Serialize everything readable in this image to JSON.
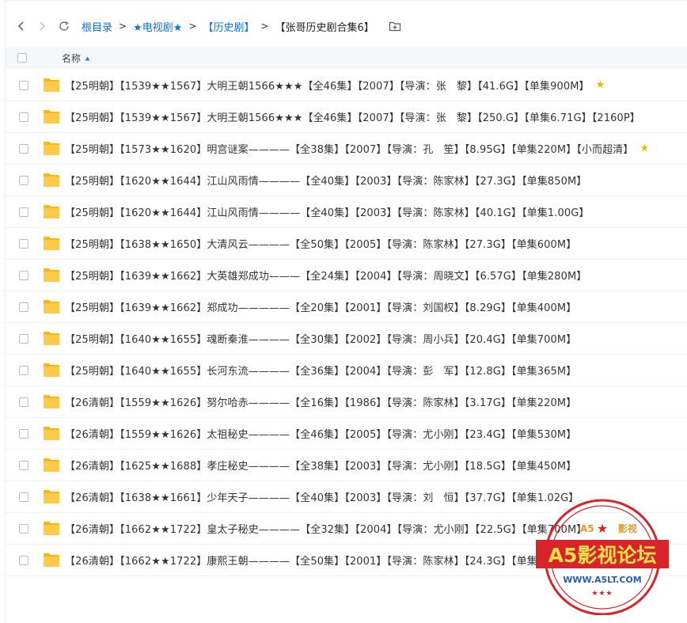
{
  "breadcrumb": {
    "items": [
      "根目录",
      "★电视剧★",
      "【历史剧】",
      "【张哥历史剧合集6】"
    ],
    "separator": ">"
  },
  "table": {
    "column_name": "名称"
  },
  "files": [
    {
      "name": "【25明朝】【1539★★1567】大明王朝1566★★★【全46集】【2007】【导演：张　黎】【41.6G】【单集900M】",
      "starred": true
    },
    {
      "name": "【25明朝】【1539★★1567】大明王朝1566★★★【全46集】【2007】【导演：张　黎】【250.G】【单集6.71G】【2160P】",
      "starred": false
    },
    {
      "name": "【25明朝】【1573★★1620】明宫谜案————【全38集】【2007】【导演：孔　笙】【8.95G】【单集220M】【小而超清】",
      "starred": true
    },
    {
      "name": "【25明朝】【1620★★1644】江山风雨情————【全40集】【2003】【导演：陈家林】【27.3G】【单集850M】",
      "starred": false
    },
    {
      "name": "【25明朝】【1620★★1644】江山风雨情————【全40集】【2003】【导演：陈家林】【40.1G】【单集1.00G】",
      "starred": false
    },
    {
      "name": "【25明朝】【1638★★1650】大清风云————【全50集】【2005】【导演：陈家林】【27.3G】【单集600M】",
      "starred": false
    },
    {
      "name": "【25明朝】【1639★★1662】大英雄郑成功———【全24集】【2004】【导演：周晓文】【6.57G】【单集280M】",
      "starred": false
    },
    {
      "name": "【25明朝】【1639★★1662】郑成功—————【全20集】【2001】【导演：刘国权】【8.29G】【单集400M】",
      "starred": false
    },
    {
      "name": "【25明朝】【1640★★1655】魂断秦淮————【全30集】【2002】【导演：周小兵】【20.4G】【单集700M】",
      "starred": false
    },
    {
      "name": "【25明朝】【1640★★1655】长河东流————【全36集】【2004】【导演：彭　军】【12.8G】【单集365M】",
      "starred": false
    },
    {
      "name": "【26清朝】【1559★★1626】努尔哈赤————【全16集】【1986】【导演：陈家林】【3.17G】【单集220M】",
      "starred": false
    },
    {
      "name": "【26清朝】【1559★★1626】太祖秘史————【全46集】【2005】【导演：尤小刚】【23.4G】【单集530M】",
      "starred": false
    },
    {
      "name": "【26清朝】【1625★★1688】孝庄秘史————【全38集】【2003】【导演：尤小刚】【18.5G】【单集450M】",
      "starred": false
    },
    {
      "name": "【26清朝】【1638★★1661】少年天子————【全40集】【2003】【导演：刘　恒】【37.7G】【单集1.02G】",
      "starred": false
    },
    {
      "name": "【26清朝】【1662★★1722】皇太子秘史————【全32集】【2004】【导演：尤小刚】【22.5G】【单集700M】",
      "starred": false
    },
    {
      "name": "【26清朝】【1662★★1722】康熙王朝————【全50集】【2001】【导演：陈家林】【24.3G】【单集500M】",
      "starred": false
    }
  ],
  "watermark": {
    "top_left": "A5",
    "top_right": "影视",
    "banner": "A5影视论坛",
    "url": "WWW.A5LT.COM"
  },
  "colors": {
    "link": "#0e6fd6",
    "folder": "#ffc533",
    "star": "#f4b400",
    "stamp_red": "#d9232b"
  }
}
